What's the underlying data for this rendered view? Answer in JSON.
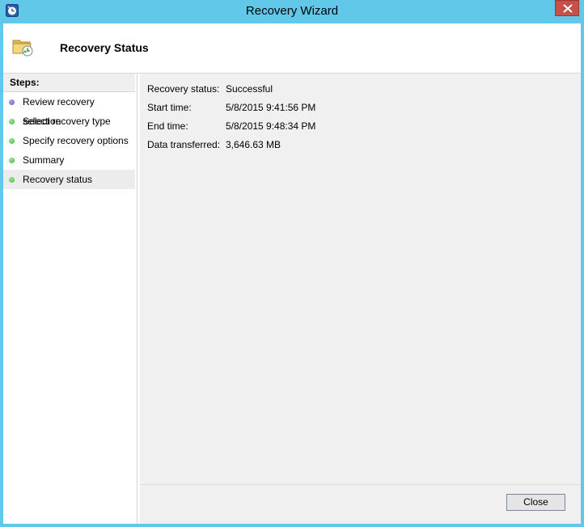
{
  "window": {
    "title": "Recovery Wizard"
  },
  "header": {
    "title": "Recovery Status"
  },
  "steps": {
    "heading": "Steps:",
    "items": [
      {
        "label": "Review recovery selection",
        "dot_color": "#6b5fc7"
      },
      {
        "label": "Select recovery type",
        "dot_color": "#3fb53a"
      },
      {
        "label": "Specify recovery options",
        "dot_color": "#3fb53a"
      },
      {
        "label": "Summary",
        "dot_color": "#3fb53a"
      },
      {
        "label": "Recovery status",
        "dot_color": "#3fb53a"
      }
    ]
  },
  "status": {
    "recovery_status_label": "Recovery status:",
    "recovery_status_value": "Successful",
    "start_time_label": "Start time:",
    "start_time_value": "5/8/2015 9:41:56 PM",
    "end_time_label": "End time:",
    "end_time_value": "5/8/2015 9:48:34 PM",
    "data_transferred_label": "Data transferred:",
    "data_transferred_value": "3,646.63 MB"
  },
  "footer": {
    "close_label": "Close"
  },
  "icons": {
    "app": "backup-clock-icon",
    "window_close": "close-icon",
    "header": "folder-recovery-icon"
  },
  "colors": {
    "titlebar": "#62c8ea",
    "close_button": "#c7504a",
    "panel": "#f0f0f0"
  }
}
